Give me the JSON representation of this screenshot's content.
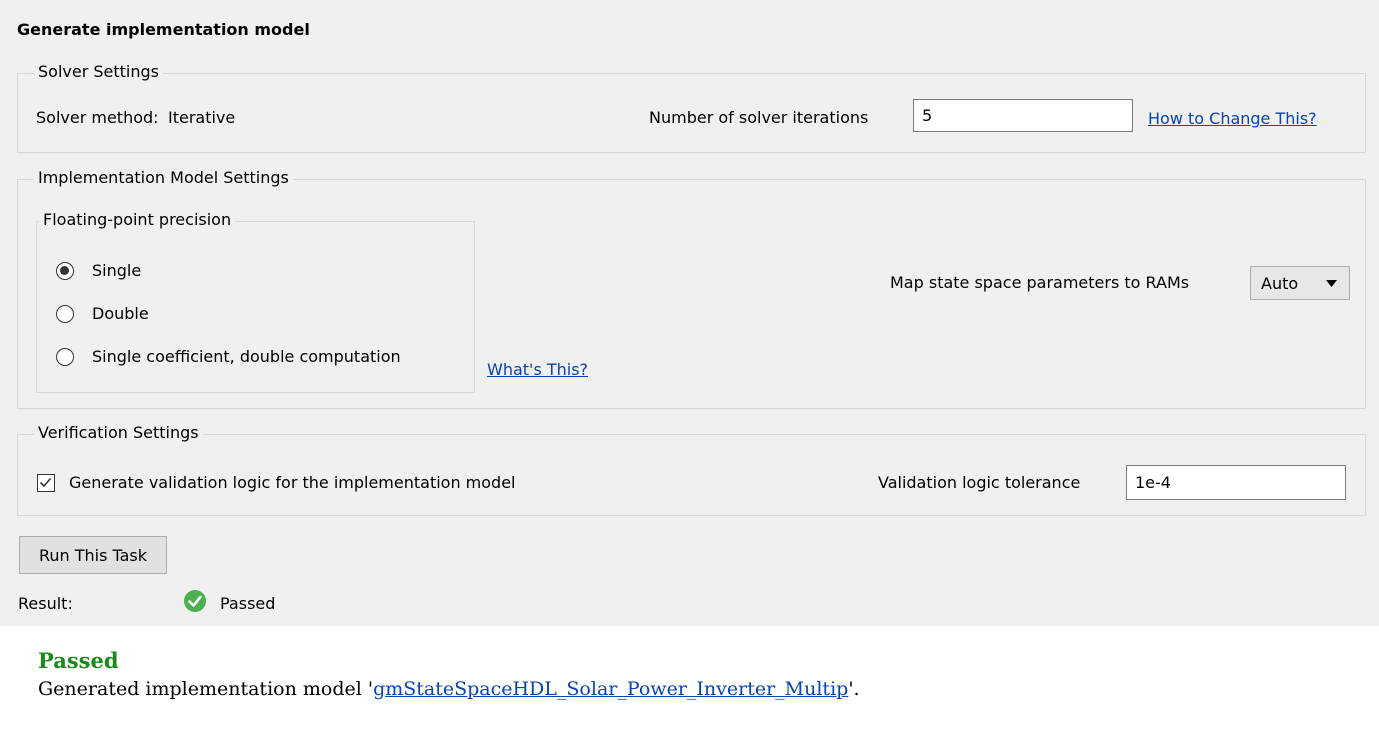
{
  "title": "Generate implementation model",
  "solver": {
    "group_title": "Solver Settings",
    "method_label": "Solver method:",
    "method_value": "Iterative",
    "iterations_label": "Number of solver iterations",
    "iterations_value": "5",
    "help_link": "How to Change This?"
  },
  "impl": {
    "group_title": "Implementation Model Settings",
    "precision_group_title": "Floating-point precision",
    "options": [
      {
        "label": "Single",
        "selected": true
      },
      {
        "label": "Double",
        "selected": false
      },
      {
        "label": "Single coefficient, double computation",
        "selected": false
      }
    ],
    "whats_this_link": "What's This?",
    "map_label": "Map state space parameters to RAMs",
    "map_value": "Auto"
  },
  "verify": {
    "group_title": "Verification Settings",
    "checkbox_label": "Generate validation logic for the implementation model",
    "checkbox_checked": true,
    "tolerance_label": "Validation logic tolerance",
    "tolerance_value": "1e-4"
  },
  "run_button": "Run This Task",
  "result": {
    "label": "Result:",
    "status": "Passed",
    "status_color": "#4caf50"
  },
  "report": {
    "heading": "Passed",
    "heading_color": "#1a8a1a",
    "message_prefix": "Generated implementation model '",
    "model_link": "gmStateSpaceHDL_Solar_Power_Inverter_Multip",
    "message_suffix": "'."
  }
}
